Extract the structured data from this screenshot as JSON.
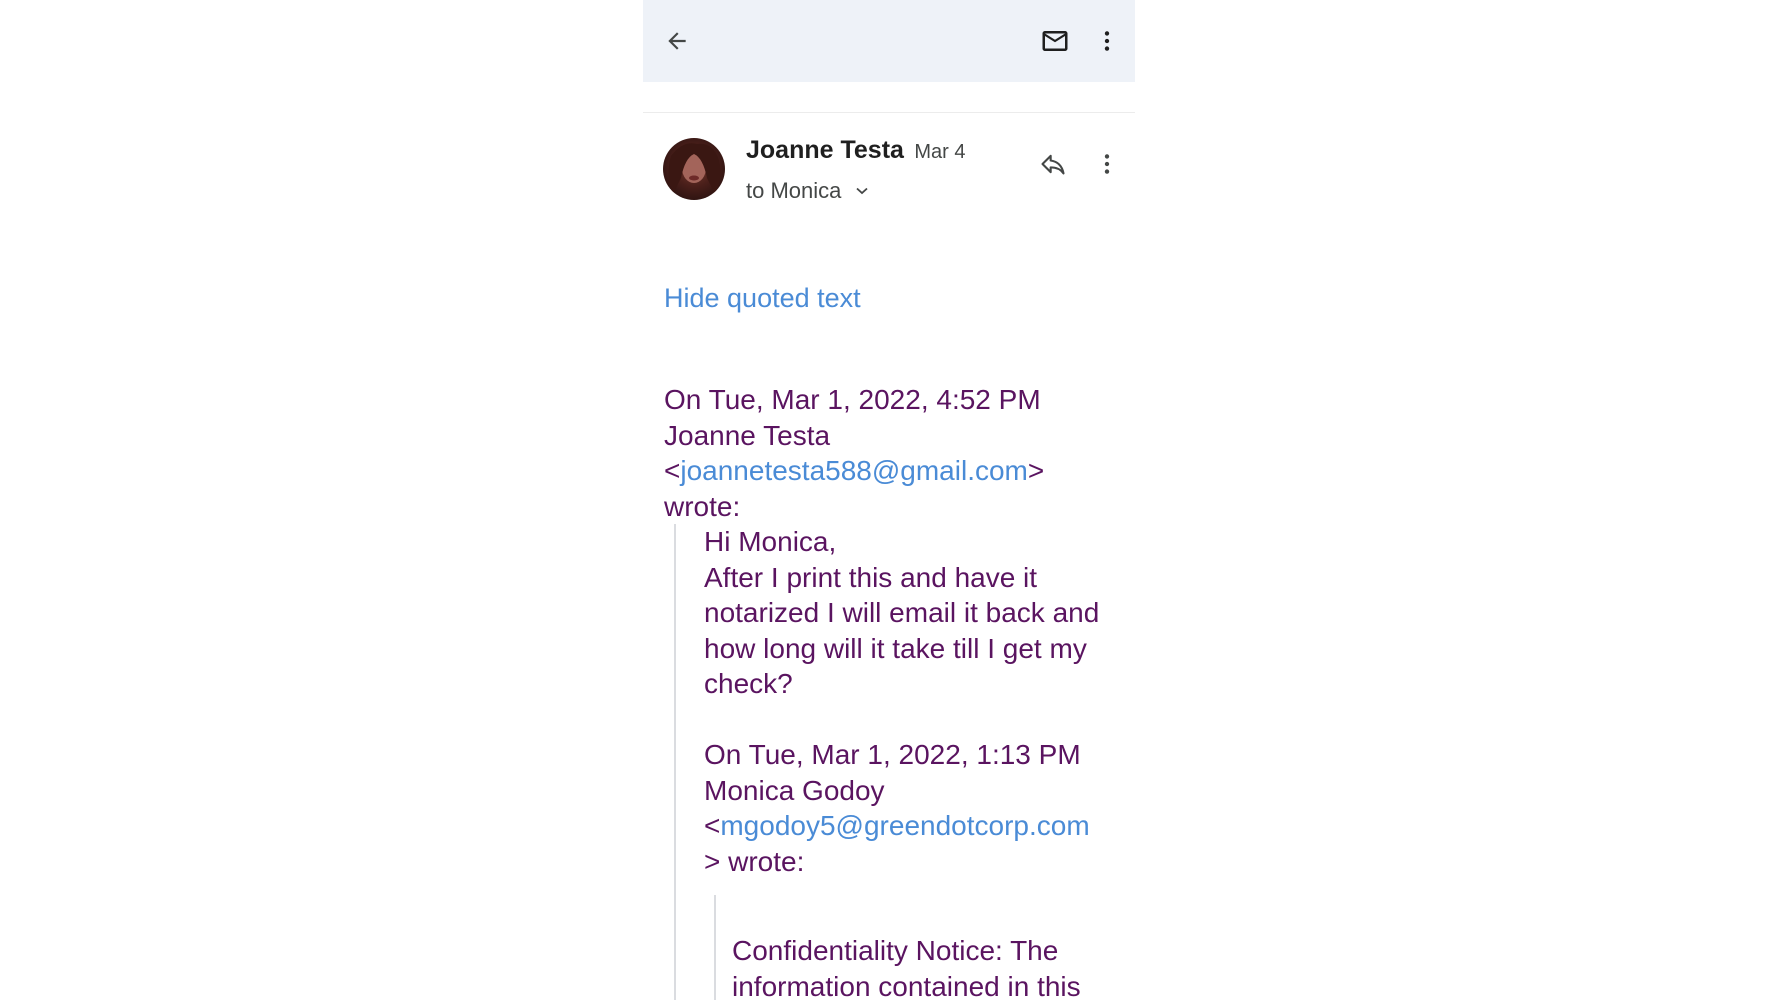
{
  "toolbar": {
    "back_icon": "arrow-back-icon",
    "mail_icon": "mail-icon",
    "more_icon": "more-vertical-icon"
  },
  "message": {
    "sender_name": "Joanne Testa",
    "date": "Mar 4",
    "recipient": "to Monica",
    "reply_icon": "reply-icon",
    "more_icon": "more-vertical-icon",
    "avatar_icon": "avatar"
  },
  "hide_quoted_label": "Hide quoted text",
  "quote1": {
    "attribution_line1": "On Tue, Mar 1, 2022, 4:52 PM",
    "attribution_line2": "Joanne Testa",
    "open_bracket": "<",
    "email": "joannetesta588@gmail.com",
    "close_bracket": ">",
    "wrote": "wrote:",
    "greeting": "Hi Monica,",
    "body": "After I print this and have it notarized I will email it back and how long will it take till I get my check?"
  },
  "quote2": {
    "attribution_line1": "On Tue, Mar 1, 2022, 1:13 PM",
    "attribution_line2": "Monica Godoy",
    "open_bracket": "<",
    "email": "mgodoy5@greendotcorp.com",
    "wrote": "> wrote:",
    "notice": "Confidentiality Notice:  The information contained in this"
  },
  "colors": {
    "toolbar_bg": "#eef2f8",
    "link": "#4a8bd6",
    "quoted_text": "#5a1460"
  }
}
